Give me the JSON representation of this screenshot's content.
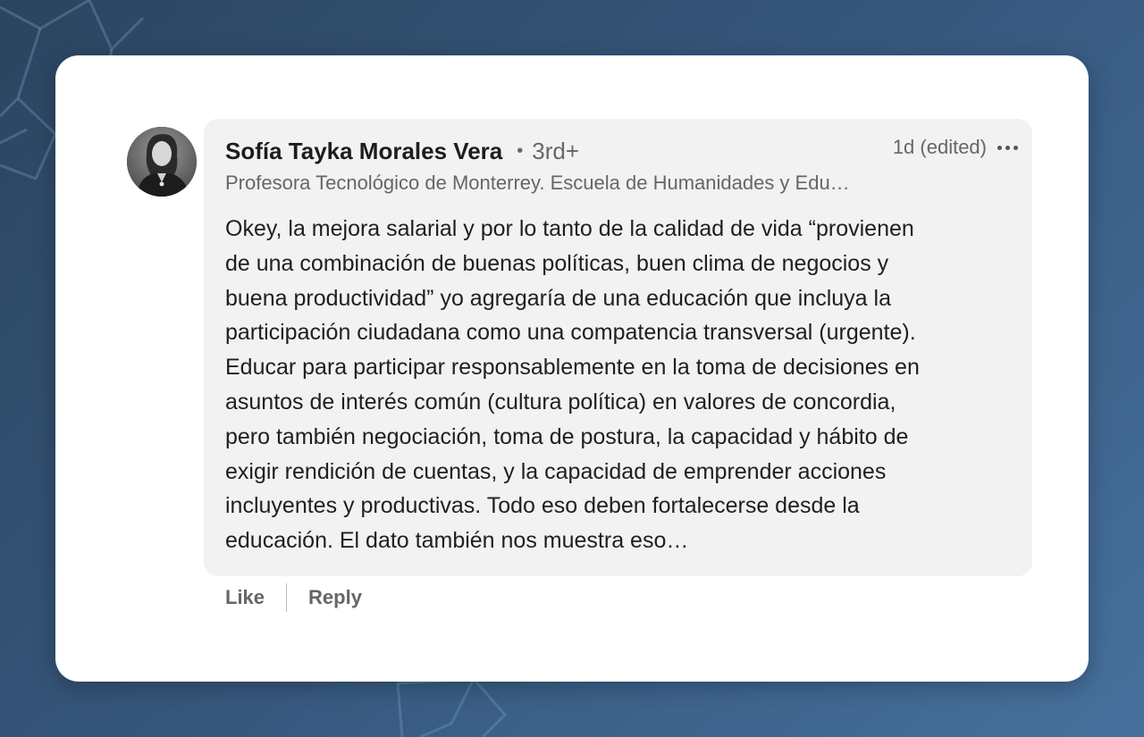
{
  "comment": {
    "author": {
      "name": "Sofía Tayka Morales Vera",
      "degree": "3rd+",
      "headline": "Profesora Tecnológico de Monterrey. Escuela de Humanidades y Edu…"
    },
    "meta": {
      "time": "1d (edited)",
      "more_icon": "ellipsis-icon"
    },
    "text_lines": [
      "Okey, la mejora salarial y por lo tanto de la calidad de vida “provienen",
      "de una combinación de buenas políticas, buen clima de negocios y",
      "buena productividad” yo agregaría de una educación que incluya la",
      "participación ciudadana como una compatencia transversal (urgente).",
      "Educar para participar responsablemente en la toma de decisiones en",
      "asuntos de interés común (cultura política) en valores de concordia,",
      "pero también negociación, toma de postura, la capacidad y hábito de",
      "exigir rendición de cuentas, y la capacidad de emprender acciones",
      "incluyentes y productivas. Todo eso deben fortalecerse desde la",
      "educación. El dato también nos muestra eso…"
    ]
  },
  "actions": {
    "like_label": "Like",
    "reply_label": "Reply"
  },
  "colors": {
    "background": "#35557a",
    "card": "#ffffff",
    "bubble": "#f2f2f2",
    "secondary_text": "#666666"
  }
}
